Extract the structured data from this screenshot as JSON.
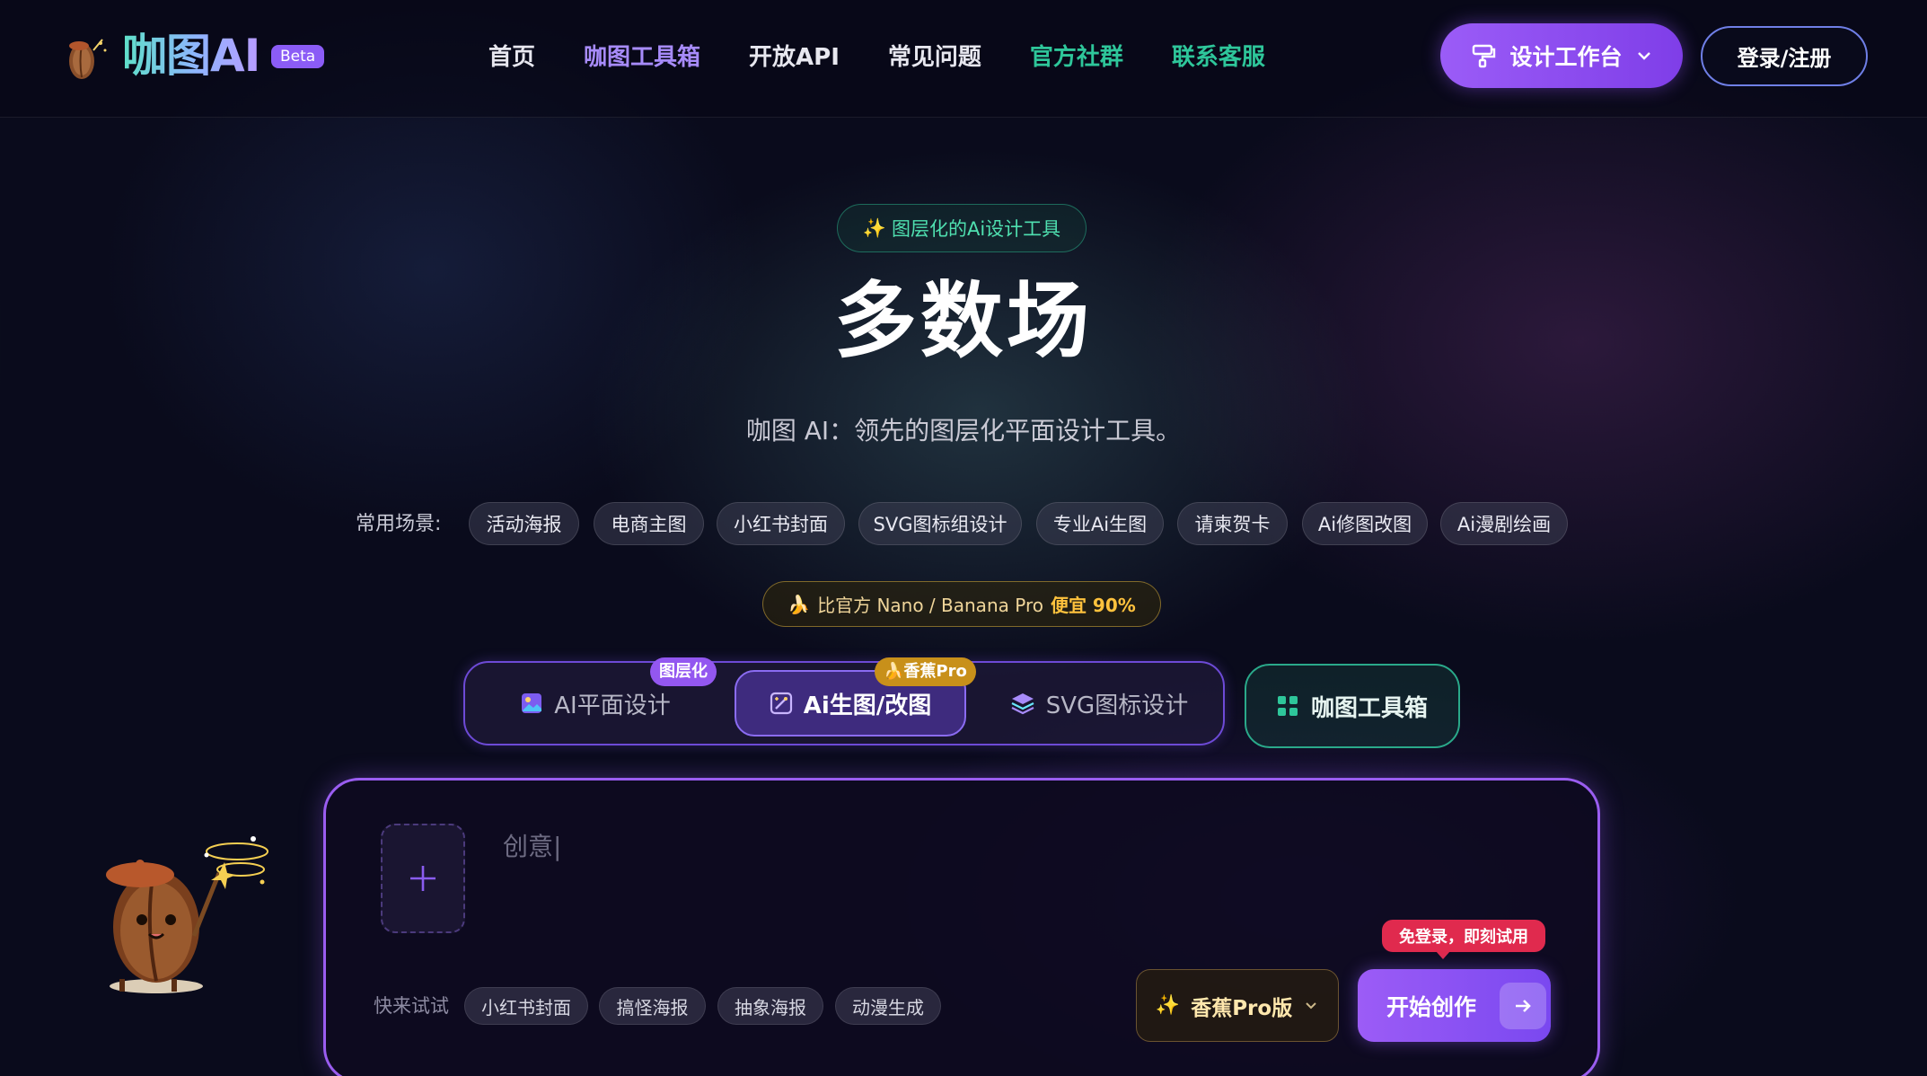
{
  "header": {
    "logo_text": "咖图AI",
    "beta_badge": "Beta",
    "nav": [
      {
        "label": "首页",
        "color": "#e7e7ef"
      },
      {
        "label": "咖图工具箱",
        "color": "#a78bfa"
      },
      {
        "label": "开放API",
        "color": "#e7e7ef"
      },
      {
        "label": "常见问题",
        "color": "#e7e7ef"
      },
      {
        "label": "官方社群",
        "color": "#2ec69a"
      },
      {
        "label": "联系客服",
        "color": "#2ec69a"
      }
    ],
    "workbench_label": "设计工作台",
    "login_label": "登录/注册"
  },
  "hero": {
    "tagline": "图层化的Ai设计工具",
    "title": "多数场",
    "subtitle": "咖图 AI：领先的图层化平面设计工具。"
  },
  "scenarios": {
    "label": "常用场景:",
    "items": [
      "活动海报",
      "电商主图",
      "小红书封面",
      "SVG图标组设计",
      "专业Ai生图",
      "请柬贺卡",
      "Ai修图改图",
      "Ai漫剧绘画"
    ]
  },
  "promo": {
    "text": "比官方 Nano / Banana Pro",
    "highlight": "便宜 90%"
  },
  "modes": {
    "tabs": [
      {
        "label": "AI平面设计",
        "badge": "图层化",
        "active": false
      },
      {
        "label": "Ai生图/改图",
        "badge": "香蕉Pro",
        "active": true
      },
      {
        "label": "SVG图标设计",
        "badge": "",
        "active": false
      }
    ],
    "toolbox_label": "咖图工具箱"
  },
  "composer": {
    "placeholder": "创意|",
    "quick_label": "快来试试",
    "quick_items": [
      "小红书封面",
      "搞怪海报",
      "抽象海报",
      "动漫生成"
    ],
    "model_label": "香蕉Pro版",
    "free_tip": "免登录，即刻试用",
    "start_label": "开始创作"
  },
  "colors": {
    "accent_purple": "#9b5cf7",
    "accent_green": "#2ec69a",
    "promo_gold": "#ffc23d",
    "tip_red": "#e02a4e"
  },
  "icons": {
    "workbench": "painter-roller-icon",
    "toolbox": "grid-icon",
    "upload": "plus-icon",
    "start": "arrow-right-icon"
  }
}
